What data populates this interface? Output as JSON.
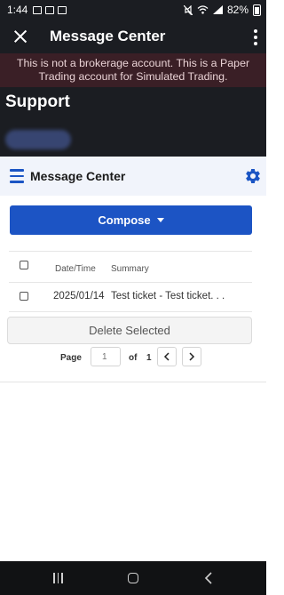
{
  "status_bar": {
    "time": "1:44",
    "battery": "82%"
  },
  "app_bar": {
    "title": "Message Center"
  },
  "banner": {
    "text": "This is not a brokerage account. This is a Paper Trading account for Simulated Trading."
  },
  "support": {
    "title": "Support"
  },
  "message_center": {
    "title": "Message Center",
    "compose_label": "Compose",
    "table": {
      "headers": {
        "date": "Date/Time",
        "summary": "Summary"
      },
      "rows": [
        {
          "date": "2025/01/14",
          "summary": "Test ticket - Test ticket. . ."
        }
      ]
    },
    "delete_label": "Delete Selected",
    "pagination": {
      "page_label": "Page",
      "placeholder": "1",
      "of_label": "of",
      "total_pages": "1"
    }
  },
  "colors": {
    "accent": "#1c54c4",
    "banner_bg": "#3a1f26",
    "app_bar_bg": "#1b1d22"
  }
}
